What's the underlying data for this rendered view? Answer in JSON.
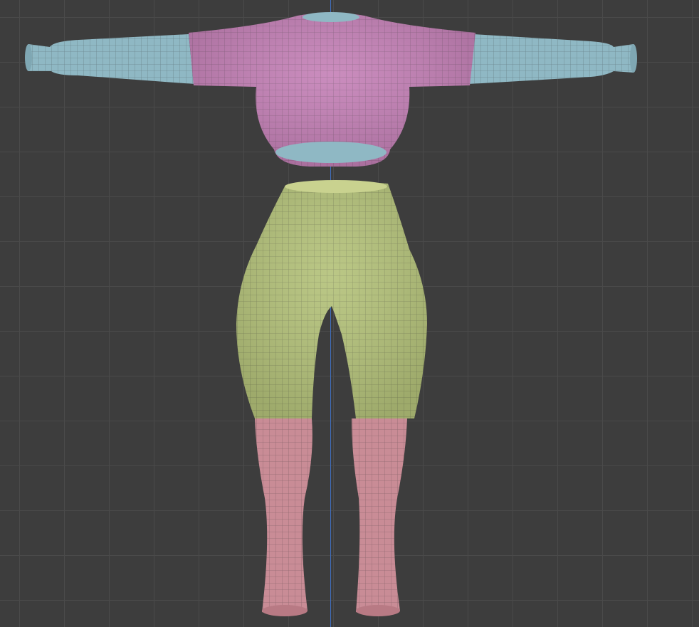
{
  "viewport": {
    "background": "#3d3d3d",
    "grid_color": "#4a4a4a",
    "z_axis_color": "#3f6fbf"
  },
  "materials": {
    "sleeves": "#8fb8c4",
    "sweater": "#c47fb6",
    "pants": "#b4c27a",
    "socks": "#c98c96",
    "wireframe": "rgba(40,40,40,0.35)"
  },
  "objects": [
    {
      "name": "crop-sweater",
      "material": "sweater"
    },
    {
      "name": "left-sleeve",
      "material": "sleeves"
    },
    {
      "name": "right-sleeve",
      "material": "sleeves"
    },
    {
      "name": "leggings",
      "material": "pants"
    },
    {
      "name": "left-sock",
      "material": "socks"
    },
    {
      "name": "right-sock",
      "material": "socks"
    }
  ]
}
